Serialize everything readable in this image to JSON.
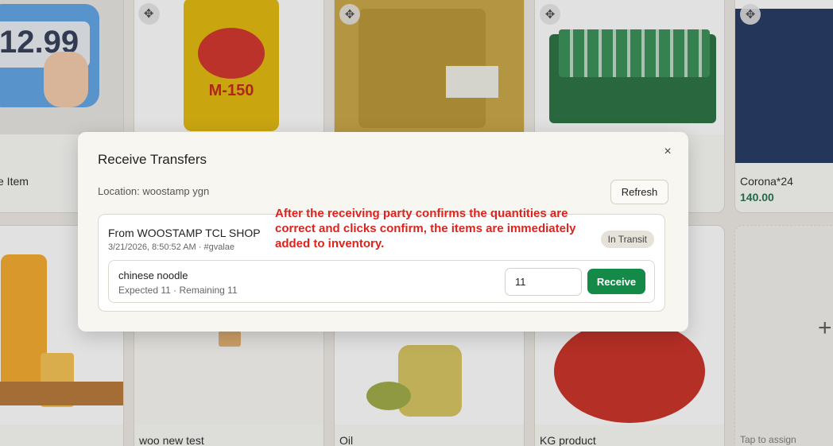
{
  "background": {
    "tiles": [
      {
        "name": "e Item",
        "price": ""
      },
      {
        "name": "",
        "price": ""
      },
      {
        "name": "",
        "price": ""
      },
      {
        "name": "",
        "price": ""
      },
      {
        "name": "Corona*24",
        "price": "140.00"
      },
      {
        "name": "",
        "price": ""
      },
      {
        "name": "woo new test",
        "price": ""
      },
      {
        "name": "Oil",
        "price": ""
      },
      {
        "name": "KG product",
        "price": ""
      },
      {
        "name": "Tap to assign",
        "price": ""
      }
    ],
    "price_sign_text": "12.99",
    "can_brand_text": "M-150"
  },
  "modal": {
    "title": "Receive Transfers",
    "close_glyph": "×",
    "location": "Location: woostamp ygn",
    "refresh_label": "Refresh",
    "transfer": {
      "from": "From WOOSTAMP TCL SHOP",
      "meta": "3/21/2026, 8:50:52 AM · #gvalae",
      "status": "In Transit",
      "item": {
        "name": "chinese noodle",
        "details": "Expected 11 · Remaining 11",
        "quantity": "11",
        "receive_label": "Receive"
      }
    }
  },
  "annotation": "After the receiving party confirms the quantities are correct and clicks confirm, the items are immediately added to inventory.",
  "colors": {
    "accent": "#138a47",
    "price": "#1d6b45",
    "annotation": "#e0221c"
  }
}
